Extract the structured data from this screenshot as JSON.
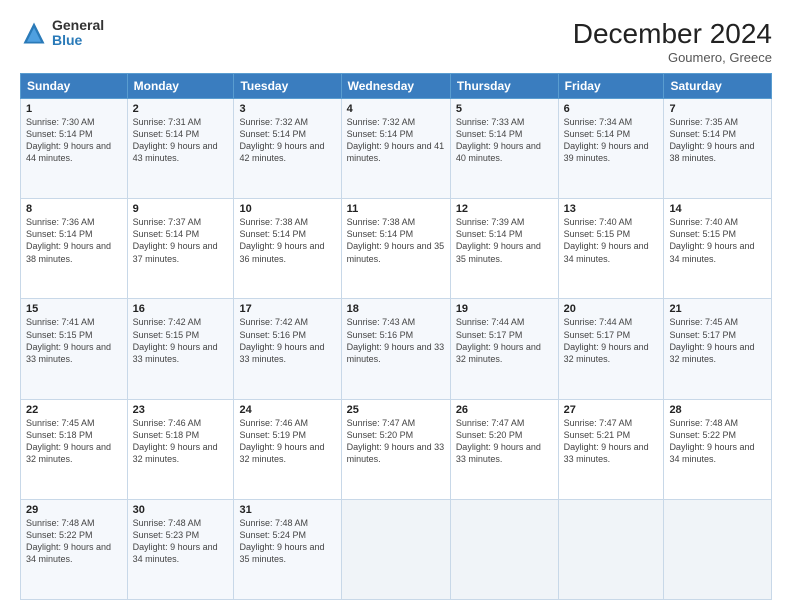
{
  "logo": {
    "general": "General",
    "blue": "Blue"
  },
  "header": {
    "month": "December 2024",
    "location": "Goumero, Greece"
  },
  "days_of_week": [
    "Sunday",
    "Monday",
    "Tuesday",
    "Wednesday",
    "Thursday",
    "Friday",
    "Saturday"
  ],
  "weeks": [
    [
      {
        "day": "1",
        "sunrise": "Sunrise: 7:30 AM",
        "sunset": "Sunset: 5:14 PM",
        "daylight": "Daylight: 9 hours and 44 minutes."
      },
      {
        "day": "2",
        "sunrise": "Sunrise: 7:31 AM",
        "sunset": "Sunset: 5:14 PM",
        "daylight": "Daylight: 9 hours and 43 minutes."
      },
      {
        "day": "3",
        "sunrise": "Sunrise: 7:32 AM",
        "sunset": "Sunset: 5:14 PM",
        "daylight": "Daylight: 9 hours and 42 minutes."
      },
      {
        "day": "4",
        "sunrise": "Sunrise: 7:32 AM",
        "sunset": "Sunset: 5:14 PM",
        "daylight": "Daylight: 9 hours and 41 minutes."
      },
      {
        "day": "5",
        "sunrise": "Sunrise: 7:33 AM",
        "sunset": "Sunset: 5:14 PM",
        "daylight": "Daylight: 9 hours and 40 minutes."
      },
      {
        "day": "6",
        "sunrise": "Sunrise: 7:34 AM",
        "sunset": "Sunset: 5:14 PM",
        "daylight": "Daylight: 9 hours and 39 minutes."
      },
      {
        "day": "7",
        "sunrise": "Sunrise: 7:35 AM",
        "sunset": "Sunset: 5:14 PM",
        "daylight": "Daylight: 9 hours and 38 minutes."
      }
    ],
    [
      {
        "day": "8",
        "sunrise": "Sunrise: 7:36 AM",
        "sunset": "Sunset: 5:14 PM",
        "daylight": "Daylight: 9 hours and 38 minutes."
      },
      {
        "day": "9",
        "sunrise": "Sunrise: 7:37 AM",
        "sunset": "Sunset: 5:14 PM",
        "daylight": "Daylight: 9 hours and 37 minutes."
      },
      {
        "day": "10",
        "sunrise": "Sunrise: 7:38 AM",
        "sunset": "Sunset: 5:14 PM",
        "daylight": "Daylight: 9 hours and 36 minutes."
      },
      {
        "day": "11",
        "sunrise": "Sunrise: 7:38 AM",
        "sunset": "Sunset: 5:14 PM",
        "daylight": "Daylight: 9 hours and 35 minutes."
      },
      {
        "day": "12",
        "sunrise": "Sunrise: 7:39 AM",
        "sunset": "Sunset: 5:14 PM",
        "daylight": "Daylight: 9 hours and 35 minutes."
      },
      {
        "day": "13",
        "sunrise": "Sunrise: 7:40 AM",
        "sunset": "Sunset: 5:15 PM",
        "daylight": "Daylight: 9 hours and 34 minutes."
      },
      {
        "day": "14",
        "sunrise": "Sunrise: 7:40 AM",
        "sunset": "Sunset: 5:15 PM",
        "daylight": "Daylight: 9 hours and 34 minutes."
      }
    ],
    [
      {
        "day": "15",
        "sunrise": "Sunrise: 7:41 AM",
        "sunset": "Sunset: 5:15 PM",
        "daylight": "Daylight: 9 hours and 33 minutes."
      },
      {
        "day": "16",
        "sunrise": "Sunrise: 7:42 AM",
        "sunset": "Sunset: 5:15 PM",
        "daylight": "Daylight: 9 hours and 33 minutes."
      },
      {
        "day": "17",
        "sunrise": "Sunrise: 7:42 AM",
        "sunset": "Sunset: 5:16 PM",
        "daylight": "Daylight: 9 hours and 33 minutes."
      },
      {
        "day": "18",
        "sunrise": "Sunrise: 7:43 AM",
        "sunset": "Sunset: 5:16 PM",
        "daylight": "Daylight: 9 hours and 33 minutes."
      },
      {
        "day": "19",
        "sunrise": "Sunrise: 7:44 AM",
        "sunset": "Sunset: 5:17 PM",
        "daylight": "Daylight: 9 hours and 32 minutes."
      },
      {
        "day": "20",
        "sunrise": "Sunrise: 7:44 AM",
        "sunset": "Sunset: 5:17 PM",
        "daylight": "Daylight: 9 hours and 32 minutes."
      },
      {
        "day": "21",
        "sunrise": "Sunrise: 7:45 AM",
        "sunset": "Sunset: 5:17 PM",
        "daylight": "Daylight: 9 hours and 32 minutes."
      }
    ],
    [
      {
        "day": "22",
        "sunrise": "Sunrise: 7:45 AM",
        "sunset": "Sunset: 5:18 PM",
        "daylight": "Daylight: 9 hours and 32 minutes."
      },
      {
        "day": "23",
        "sunrise": "Sunrise: 7:46 AM",
        "sunset": "Sunset: 5:18 PM",
        "daylight": "Daylight: 9 hours and 32 minutes."
      },
      {
        "day": "24",
        "sunrise": "Sunrise: 7:46 AM",
        "sunset": "Sunset: 5:19 PM",
        "daylight": "Daylight: 9 hours and 32 minutes."
      },
      {
        "day": "25",
        "sunrise": "Sunrise: 7:47 AM",
        "sunset": "Sunset: 5:20 PM",
        "daylight": "Daylight: 9 hours and 33 minutes."
      },
      {
        "day": "26",
        "sunrise": "Sunrise: 7:47 AM",
        "sunset": "Sunset: 5:20 PM",
        "daylight": "Daylight: 9 hours and 33 minutes."
      },
      {
        "day": "27",
        "sunrise": "Sunrise: 7:47 AM",
        "sunset": "Sunset: 5:21 PM",
        "daylight": "Daylight: 9 hours and 33 minutes."
      },
      {
        "day": "28",
        "sunrise": "Sunrise: 7:48 AM",
        "sunset": "Sunset: 5:22 PM",
        "daylight": "Daylight: 9 hours and 34 minutes."
      }
    ],
    [
      {
        "day": "29",
        "sunrise": "Sunrise: 7:48 AM",
        "sunset": "Sunset: 5:22 PM",
        "daylight": "Daylight: 9 hours and 34 minutes."
      },
      {
        "day": "30",
        "sunrise": "Sunrise: 7:48 AM",
        "sunset": "Sunset: 5:23 PM",
        "daylight": "Daylight: 9 hours and 34 minutes."
      },
      {
        "day": "31",
        "sunrise": "Sunrise: 7:48 AM",
        "sunset": "Sunset: 5:24 PM",
        "daylight": "Daylight: 9 hours and 35 minutes."
      },
      null,
      null,
      null,
      null
    ]
  ]
}
